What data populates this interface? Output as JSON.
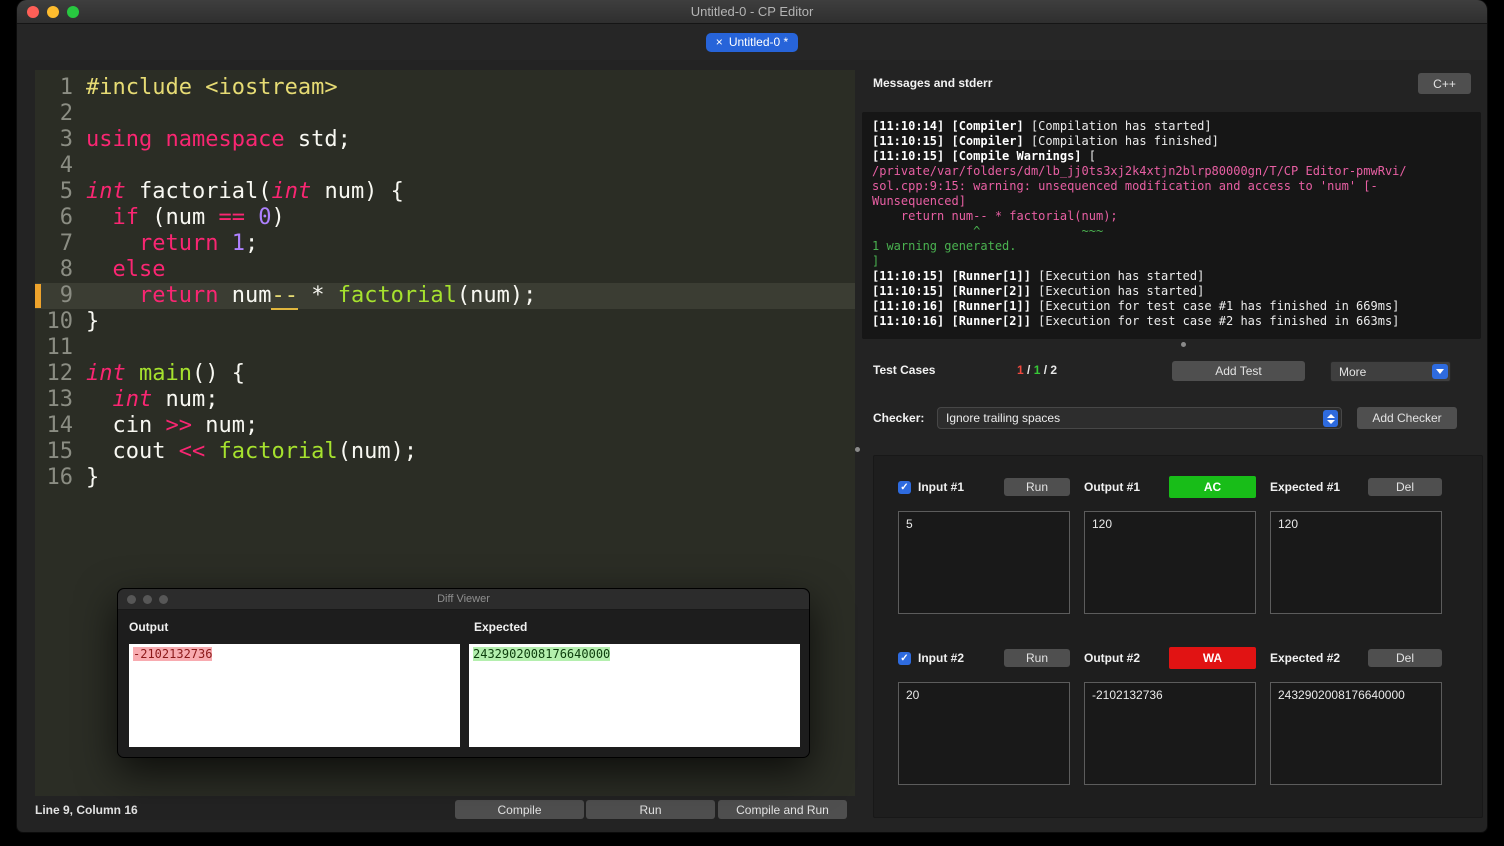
{
  "chrome": {
    "title": "Untitled-0 - CP Editor",
    "tab": {
      "close": "×",
      "label": "Untitled-0 *"
    }
  },
  "editor": {
    "current_line": 9,
    "lines": [
      {
        "n": "1",
        "segs": [
          {
            "c": "s",
            "t": "#include <iostream>"
          }
        ]
      },
      {
        "n": "2",
        "segs": []
      },
      {
        "n": "3",
        "segs": [
          {
            "c": "k",
            "t": "using namespace"
          },
          {
            "c": "p",
            "t": " std;"
          }
        ]
      },
      {
        "n": "4",
        "segs": []
      },
      {
        "n": "5",
        "segs": [
          {
            "c": "t",
            "t": "int"
          },
          {
            "c": "p",
            "t": " factorial("
          },
          {
            "c": "t",
            "t": "int"
          },
          {
            "c": "p",
            "t": " num) {"
          }
        ]
      },
      {
        "n": "6",
        "segs": [
          {
            "c": "p",
            "t": "  "
          },
          {
            "c": "k",
            "t": "if"
          },
          {
            "c": "p",
            "t": " (num "
          },
          {
            "c": "k",
            "t": "=="
          },
          {
            "c": "p",
            "t": " "
          },
          {
            "c": "n",
            "t": "0"
          },
          {
            "c": "p",
            "t": ")"
          }
        ]
      },
      {
        "n": "7",
        "segs": [
          {
            "c": "p",
            "t": "    "
          },
          {
            "c": "k",
            "t": "return"
          },
          {
            "c": "p",
            "t": " "
          },
          {
            "c": "n",
            "t": "1"
          },
          {
            "c": "p",
            "t": ";"
          }
        ]
      },
      {
        "n": "8",
        "segs": [
          {
            "c": "p",
            "t": "  "
          },
          {
            "c": "k",
            "t": "else"
          }
        ]
      },
      {
        "n": "9",
        "segs": [
          {
            "c": "p",
            "t": "    "
          },
          {
            "c": "k",
            "t": "return"
          },
          {
            "c": "p",
            "t": " num"
          },
          {
            "c": "u",
            "t": "--"
          },
          {
            "c": "p",
            "t": " * "
          },
          {
            "c": "f",
            "t": "factorial"
          },
          {
            "c": "p",
            "t": "(num);"
          }
        ]
      },
      {
        "n": "10",
        "segs": [
          {
            "c": "p",
            "t": "}"
          }
        ]
      },
      {
        "n": "11",
        "segs": []
      },
      {
        "n": "12",
        "segs": [
          {
            "c": "t",
            "t": "int"
          },
          {
            "c": "p",
            "t": " "
          },
          {
            "c": "f",
            "t": "main"
          },
          {
            "c": "p",
            "t": "() {"
          }
        ]
      },
      {
        "n": "13",
        "segs": [
          {
            "c": "p",
            "t": "  "
          },
          {
            "c": "t",
            "t": "int"
          },
          {
            "c": "p",
            "t": " num;"
          }
        ]
      },
      {
        "n": "14",
        "segs": [
          {
            "c": "p",
            "t": "  cin "
          },
          {
            "c": "k",
            "t": ">>"
          },
          {
            "c": "p",
            "t": " num;"
          }
        ]
      },
      {
        "n": "15",
        "segs": [
          {
            "c": "p",
            "t": "  cout "
          },
          {
            "c": "k",
            "t": "<<"
          },
          {
            "c": "p",
            "t": " "
          },
          {
            "c": "f",
            "t": "factorial"
          },
          {
            "c": "p",
            "t": "(num);"
          }
        ]
      },
      {
        "n": "16",
        "segs": [
          {
            "c": "p",
            "t": "}"
          }
        ]
      }
    ]
  },
  "status": {
    "text": "Line 9, Column 16"
  },
  "actions": {
    "compile": "Compile",
    "run": "Run",
    "compile_and_run": "Compile and Run"
  },
  "messages": {
    "header": "Messages and stderr",
    "language": "C++",
    "console": [
      {
        "segs": [
          {
            "c": "b",
            "t": "[11:10:14] [Compiler] "
          },
          {
            "c": "w",
            "t": "[Compilation has started]"
          }
        ]
      },
      {
        "segs": [
          {
            "c": "b",
            "t": "[11:10:15] [Compiler] "
          },
          {
            "c": "w",
            "t": "[Compilation has finished]"
          }
        ]
      },
      {
        "segs": [
          {
            "c": "b",
            "t": "[11:10:15] [Compile Warnings] "
          },
          {
            "c": "w",
            "t": "["
          }
        ]
      },
      {
        "segs": [
          {
            "c": "p",
            "t": "/private/var/folders/dm/lb_jj0ts3xj2k4xtjn2blrp80000gn/T/CP Editor-pmwRvi/"
          }
        ]
      },
      {
        "segs": [
          {
            "c": "p",
            "t": "sol.cpp:9:15: warning: unsequenced modification and access to 'num' [-"
          }
        ]
      },
      {
        "segs": [
          {
            "c": "p",
            "t": "Wunsequenced]"
          }
        ]
      },
      {
        "segs": [
          {
            "c": "p",
            "t": "    return num-- * factorial(num);"
          }
        ]
      },
      {
        "segs": [
          {
            "c": "g",
            "t": "              ^              ~~~"
          }
        ]
      },
      {
        "segs": [
          {
            "c": "g",
            "t": "1 warning generated."
          }
        ]
      },
      {
        "segs": [
          {
            "c": "g",
            "t": "]"
          }
        ]
      },
      {
        "segs": [
          {
            "c": "b",
            "t": "[11:10:15] [Runner[1]] "
          },
          {
            "c": "w",
            "t": "[Execution has started]"
          }
        ]
      },
      {
        "segs": [
          {
            "c": "b",
            "t": "[11:10:15] [Runner[2]] "
          },
          {
            "c": "w",
            "t": "[Execution has started]"
          }
        ]
      },
      {
        "segs": [
          {
            "c": "b",
            "t": "[11:10:16] [Runner[1]] "
          },
          {
            "c": "w",
            "t": "[Execution for test case #1 has finished in 669ms]"
          }
        ]
      },
      {
        "segs": [
          {
            "c": "b",
            "t": "[11:10:16] [Runner[2]] "
          },
          {
            "c": "w",
            "t": "[Execution for test case #2 has finished in 663ms]"
          }
        ]
      }
    ]
  },
  "tests": {
    "label": "Test Cases",
    "summary": [
      {
        "c": "r",
        "t": "1"
      },
      {
        "c": "d",
        "t": " / "
      },
      {
        "c": "g",
        "t": "1"
      },
      {
        "c": "d",
        "t": " / "
      },
      {
        "c": "d",
        "t": "2"
      }
    ],
    "add_test": "Add Test",
    "more": "More",
    "checker_label": "Checker:",
    "checker_value": "Ignore trailing spaces",
    "add_checker": "Add Checker",
    "run": "Run",
    "del": "Del",
    "checkbox_glyph": "✓",
    "verdict_colors": {
      "AC": "#18bd18",
      "WA": "#e11313"
    },
    "cases": [
      {
        "input_label": "Input #1",
        "output_label": "Output #1",
        "expected_label": "Expected #1",
        "verdict": "AC",
        "input": "5",
        "output": "120",
        "expected": "120"
      },
      {
        "input_label": "Input #2",
        "output_label": "Output #2",
        "expected_label": "Expected #2",
        "verdict": "WA",
        "input": "20",
        "output": "-2102132736",
        "expected": "2432902008176640000"
      }
    ]
  },
  "diff": {
    "title": "Diff Viewer",
    "output_label": "Output",
    "expected_label": "Expected",
    "output_value": "-2102132736",
    "expected_value": "2432902008176640000"
  },
  "colors": {
    "accent_blue": "#2e6bdf",
    "ac_green": "#18bd18",
    "wa_red": "#e11313",
    "diff_removed_bg": "#f8abb0",
    "diff_added_bg": "#b4efae"
  }
}
